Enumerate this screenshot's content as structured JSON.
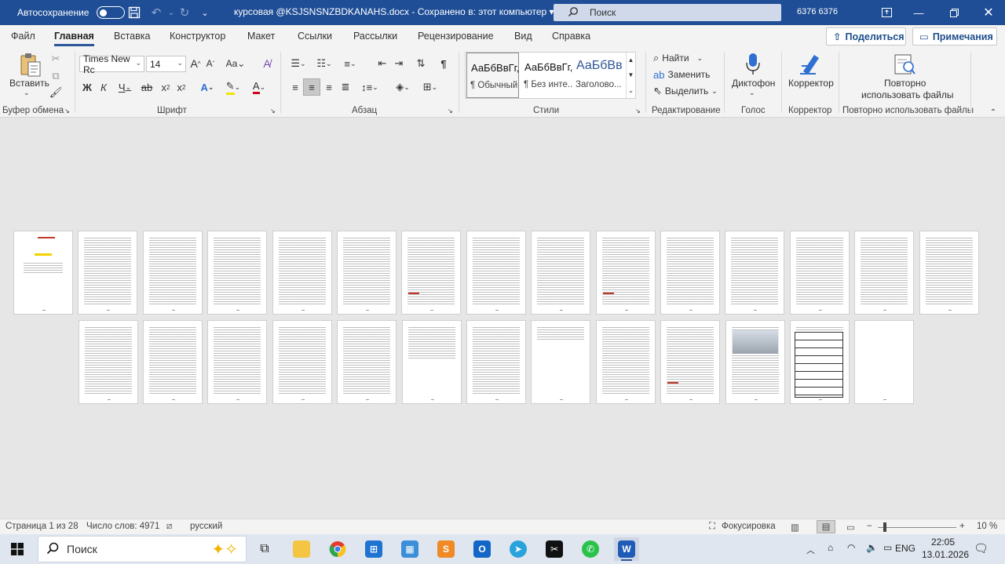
{
  "titlebar": {
    "autosave_label": "Автосохранение",
    "doc_title": "курсовая  @KSJSNSNZBDKANAHS.docx  -  Сохранено в: этот компьютер  ▾",
    "search_label": "Поиск",
    "user_name": "6376 6376"
  },
  "menu": {
    "tabs": [
      "Файл",
      "Главная",
      "Вставка",
      "Конструктор",
      "Макет",
      "Ссылки",
      "Рассылки",
      "Рецензирование",
      "Вид",
      "Справка"
    ],
    "share_label": "Поделиться",
    "comments_label": "Примечания"
  },
  "ribbon": {
    "paste_label": "Вставить",
    "clipboard_group": "Буфер обмена",
    "font_name": "Times New Rc",
    "font_size": "14",
    "font_group": "Шрифт",
    "paragraph_group": "Абзац",
    "styles": [
      {
        "sample": "АаБбВвГг,",
        "name": "¶ Обычный"
      },
      {
        "sample": "АаБбВвГг,",
        "name": "¶ Без инте..."
      },
      {
        "sample": "АаБбВв",
        "name": "Заголово..."
      }
    ],
    "styles_group": "Стили",
    "find_label": "Найти",
    "replace_label": "Заменить",
    "select_label": "Выделить",
    "editing_group": "Редактирование",
    "dictation_label": "Диктофон",
    "voice_group": "Голос",
    "editor_label": "Корректор",
    "editor_group": "Корректор",
    "reuse_label_1": "Повторно",
    "reuse_label_2": "использовать файлы",
    "reuse_group": "Повторно использовать файлы"
  },
  "document": {
    "page_count": 28
  },
  "status": {
    "page": "Страница 1 из 28",
    "words": "Число слов: 4971",
    "language": "русский",
    "focus": "Фокусировка",
    "zoom": "10 %"
  },
  "taskbar": {
    "search_label": "Поиск",
    "lang": "ENG",
    "time": "22:05",
    "date": "13.01.2026"
  }
}
